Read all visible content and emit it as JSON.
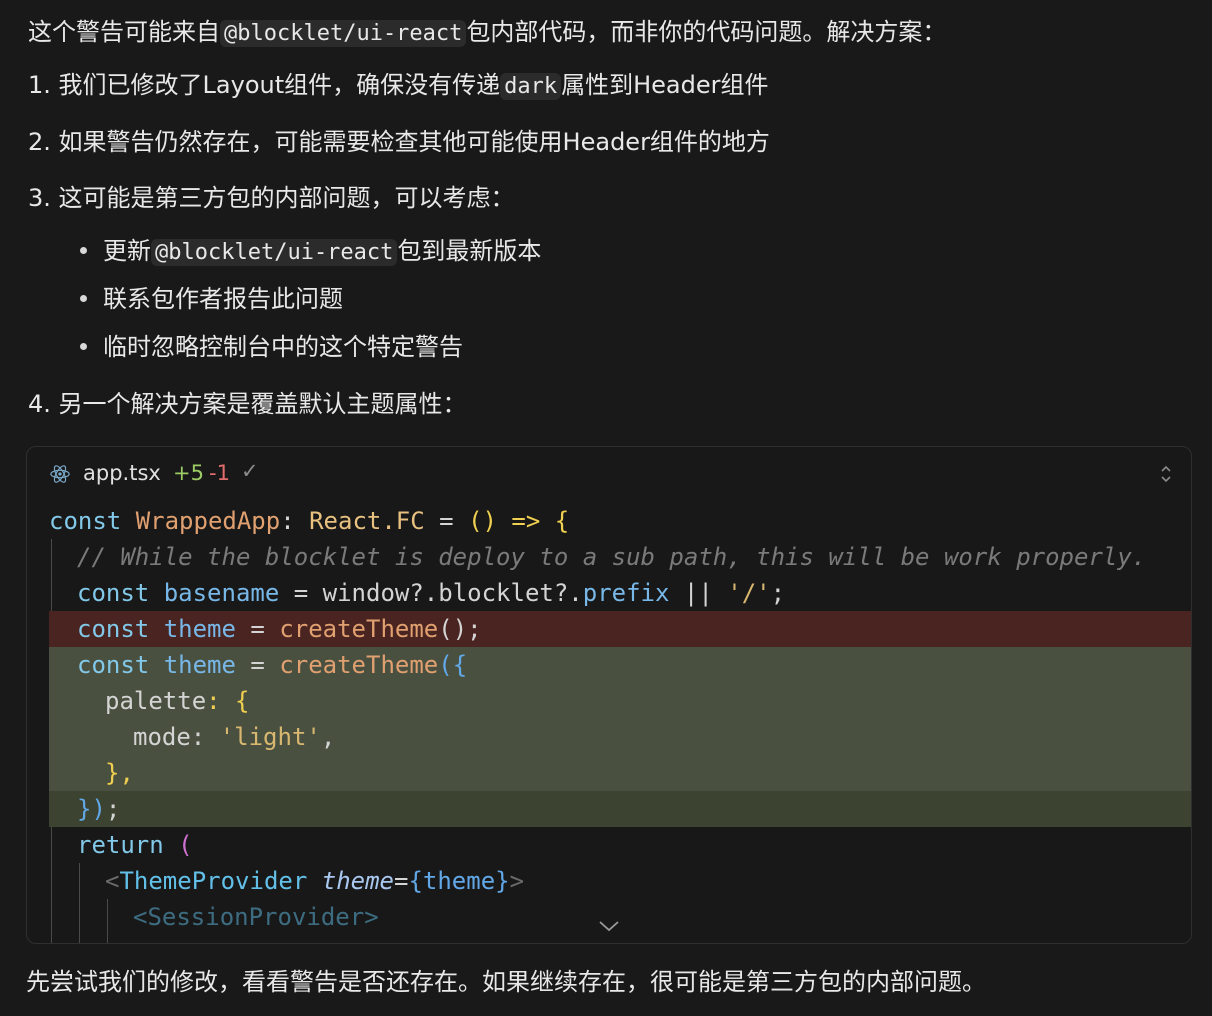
{
  "intro": {
    "prefix": "这个警告可能来自",
    "code": "@blocklet/ui-react",
    "suffix": "包内部代码，而非你的代码问题。解决方案："
  },
  "steps": [
    {
      "num": "1.",
      "prefix": "我们已修改了Layout组件，确保没有传递",
      "code": "dark",
      "suffix": "属性到Header组件"
    },
    {
      "num": "2.",
      "text": "如果警告仍然存在，可能需要检查其他可能使用Header组件的地方"
    },
    {
      "num": "3.",
      "text": "这可能是第三方包的内部问题，可以考虑："
    },
    {
      "num": "4.",
      "text": "另一个解决方案是覆盖默认主题属性："
    }
  ],
  "bullets": [
    {
      "prefix": "更新",
      "code": "@blocklet/ui-react",
      "suffix": "包到最新版本"
    },
    {
      "text": "联系包作者报告此问题"
    },
    {
      "text": "临时忽略控制台中的这个特定警告"
    }
  ],
  "codeblock": {
    "filename": "app.tsx",
    "added": "+5",
    "removed": "-1",
    "check": "✓",
    "lines": {
      "l1_kw": "const",
      "l1_name": "WrappedApp",
      "l1_colon": ":",
      "l1_type": "React.FC",
      "l1_eq": "=",
      "l1_rest": "() => {",
      "l2_comment": "// While the blocklet is deploy to a sub path, this will be work properly.",
      "l3_kw": "const",
      "l3_name": "basename",
      "l3_eq": "=",
      "l3_obj": "window?.blocklet?.",
      "l3_prop": "prefix",
      "l3_or": "||",
      "l3_str": "'/'",
      "l3_end": ";",
      "l4_kw": "const",
      "l4_name": "theme",
      "l4_eq": "=",
      "l4_fn": "createTheme",
      "l4_end": "();",
      "l5_kw": "const",
      "l5_name": "theme",
      "l5_eq": "=",
      "l5_fn": "createTheme",
      "l5_open": "({",
      "l6_key": "palette",
      "l6_rest": ": {",
      "l7_key": "mode",
      "l7_colon": ":",
      "l7_str": "'light'",
      "l7_comma": ",",
      "l8": "},",
      "l9_close": "})",
      "l9_end": ";",
      "l10_kw": "return",
      "l10_paren": "(",
      "l11_lt": "<",
      "l11_tag": "ThemeProvider",
      "l11_attr": "theme",
      "l11_eq": "=",
      "l11_val": "{theme}",
      "l11_gt": ">",
      "l12": "<SessionProvider>"
    }
  },
  "footer": "先尝试我们的修改，看看警告是否还存在。如果继续存在，很可能是第三方包的内部问题。"
}
